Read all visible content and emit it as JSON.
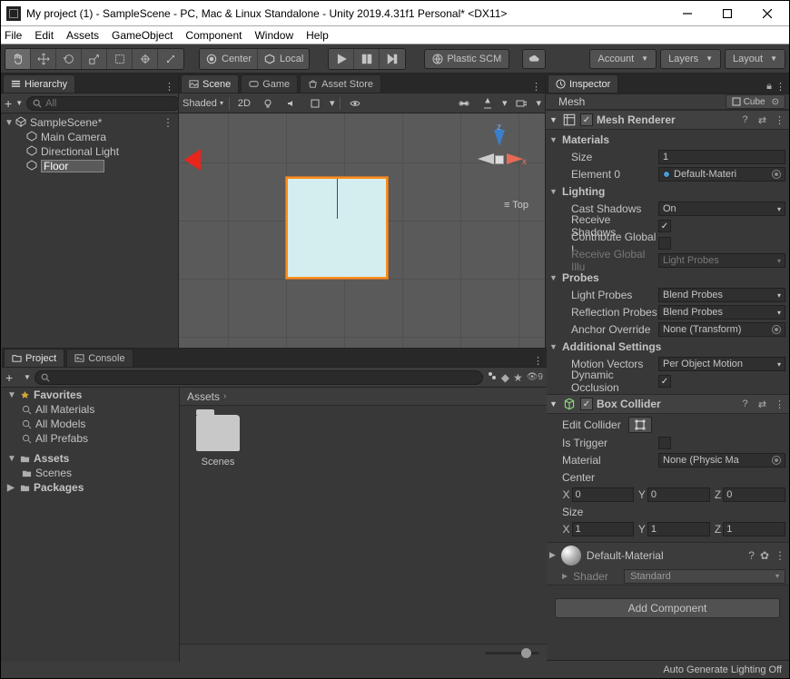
{
  "window": {
    "title": "My project (1) - SampleScene - PC, Mac & Linux Standalone - Unity 2019.4.31f1 Personal* <DX11>"
  },
  "menu": [
    "File",
    "Edit",
    "Assets",
    "GameObject",
    "Component",
    "Window",
    "Help"
  ],
  "toolbar": {
    "pivot_btn": "Center",
    "space_btn": "Local",
    "collab": "Plastic SCM",
    "account": "Account",
    "layers": "Layers",
    "layout": "Layout"
  },
  "hierarchy": {
    "tab": "Hierarchy",
    "search_placeholder": "All",
    "scene": "SampleScene*",
    "items": [
      "Main Camera",
      "Directional Light"
    ],
    "renaming": "Floor"
  },
  "scene": {
    "tabs": [
      "Scene",
      "Game",
      "Asset Store"
    ],
    "shading": "Shaded",
    "mode2d": "2D",
    "gizmo_x": "x",
    "gizmo_z": "z",
    "persp": "Top"
  },
  "project": {
    "tabs": [
      "Project",
      "Console"
    ],
    "favorites": "Favorites",
    "fav_items": [
      "All Materials",
      "All Models",
      "All Prefabs"
    ],
    "assets": "Assets",
    "assets_sub": [
      "Scenes"
    ],
    "packages": "Packages",
    "crumb": "Assets",
    "grid_item": "Scenes"
  },
  "inspector": {
    "tab": "Inspector",
    "collapsed_mesh": "Mesh",
    "collapsed_cube": "Cube",
    "mesh_renderer": {
      "title": "Mesh Renderer",
      "materials": "Materials",
      "size_lbl": "Size",
      "size_val": "1",
      "el0_lbl": "Element 0",
      "el0_val": "Default-Materi",
      "lighting": "Lighting",
      "cast_lbl": "Cast Shadows",
      "cast_val": "On",
      "recv_lbl": "Receive Shadows",
      "contrib_lbl": "Contribute Global I",
      "recvgi_lbl": "Receive Global Illu",
      "recvgi_val": "Light Probes",
      "probes": "Probes",
      "light_probes_lbl": "Light Probes",
      "light_probes_val": "Blend Probes",
      "refl_probes_lbl": "Reflection Probes",
      "refl_probes_val": "Blend Probes",
      "anchor_lbl": "Anchor Override",
      "anchor_val": "None (Transform)",
      "additional": "Additional Settings",
      "motion_lbl": "Motion Vectors",
      "motion_val": "Per Object Motion",
      "dynocc_lbl": "Dynamic Occlusion"
    },
    "box_collider": {
      "title": "Box Collider",
      "edit_lbl": "Edit Collider",
      "trigger_lbl": "Is Trigger",
      "material_lbl": "Material",
      "material_val": "None (Physic Ma",
      "center_lbl": "Center",
      "size_lbl": "Size",
      "x": "X",
      "y": "Y",
      "z": "Z",
      "cx": "0",
      "cy": "0",
      "cz": "0",
      "sx": "1",
      "sy": "1",
      "sz": "1"
    },
    "material": {
      "name": "Default-Material",
      "shader_lbl": "Shader",
      "shader_val": "Standard"
    },
    "add_component": "Add Component"
  },
  "status": "Auto Generate Lighting Off"
}
